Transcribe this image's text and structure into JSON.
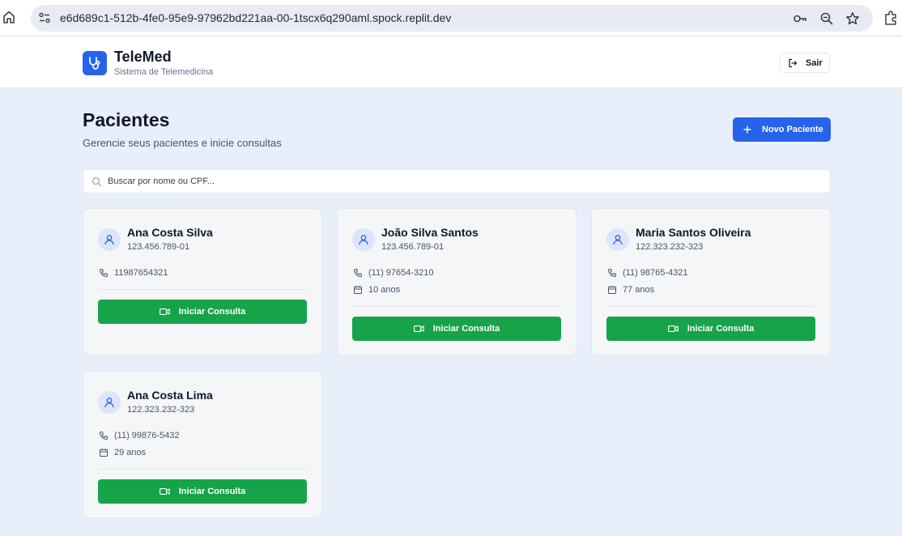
{
  "browser": {
    "url": "e6d689c1-512b-4fe0-95e9-97962bd221aa-00-1tscx6q290aml.spock.replit.dev"
  },
  "header": {
    "brand": "TeleMed",
    "subtitle": "Sistema de Telemedicina",
    "logout_label": "Sair"
  },
  "page": {
    "title": "Pacientes",
    "subtitle": "Gerencie seus pacientes e inicie consultas",
    "new_patient_label": "Novo Paciente"
  },
  "search": {
    "placeholder": "Buscar por nome ou CPF...",
    "value": ""
  },
  "patients": [
    {
      "name": "Ana Costa Silva",
      "cpf": "123.456.789-01",
      "phone": "11987654321",
      "age": "",
      "action_label": "Iniciar Consulta"
    },
    {
      "name": "João Silva Santos",
      "cpf": "123.456.789-01",
      "phone": "(11) 97654-3210",
      "age": "10 anos",
      "action_label": "Iniciar Consulta"
    },
    {
      "name": "Maria Santos Oliveira",
      "cpf": "122.323.232-323",
      "phone": "(11) 98765-4321",
      "age": "77 anos",
      "action_label": "Iniciar Consulta"
    },
    {
      "name": "Ana Costa Lima",
      "cpf": "122.323.232-323",
      "phone": "(11) 99876-5432",
      "age": "29 anos",
      "action_label": "Iniciar Consulta"
    }
  ],
  "colors": {
    "primary": "#2563eb",
    "success": "#16a34a",
    "background": "#e9effa"
  }
}
